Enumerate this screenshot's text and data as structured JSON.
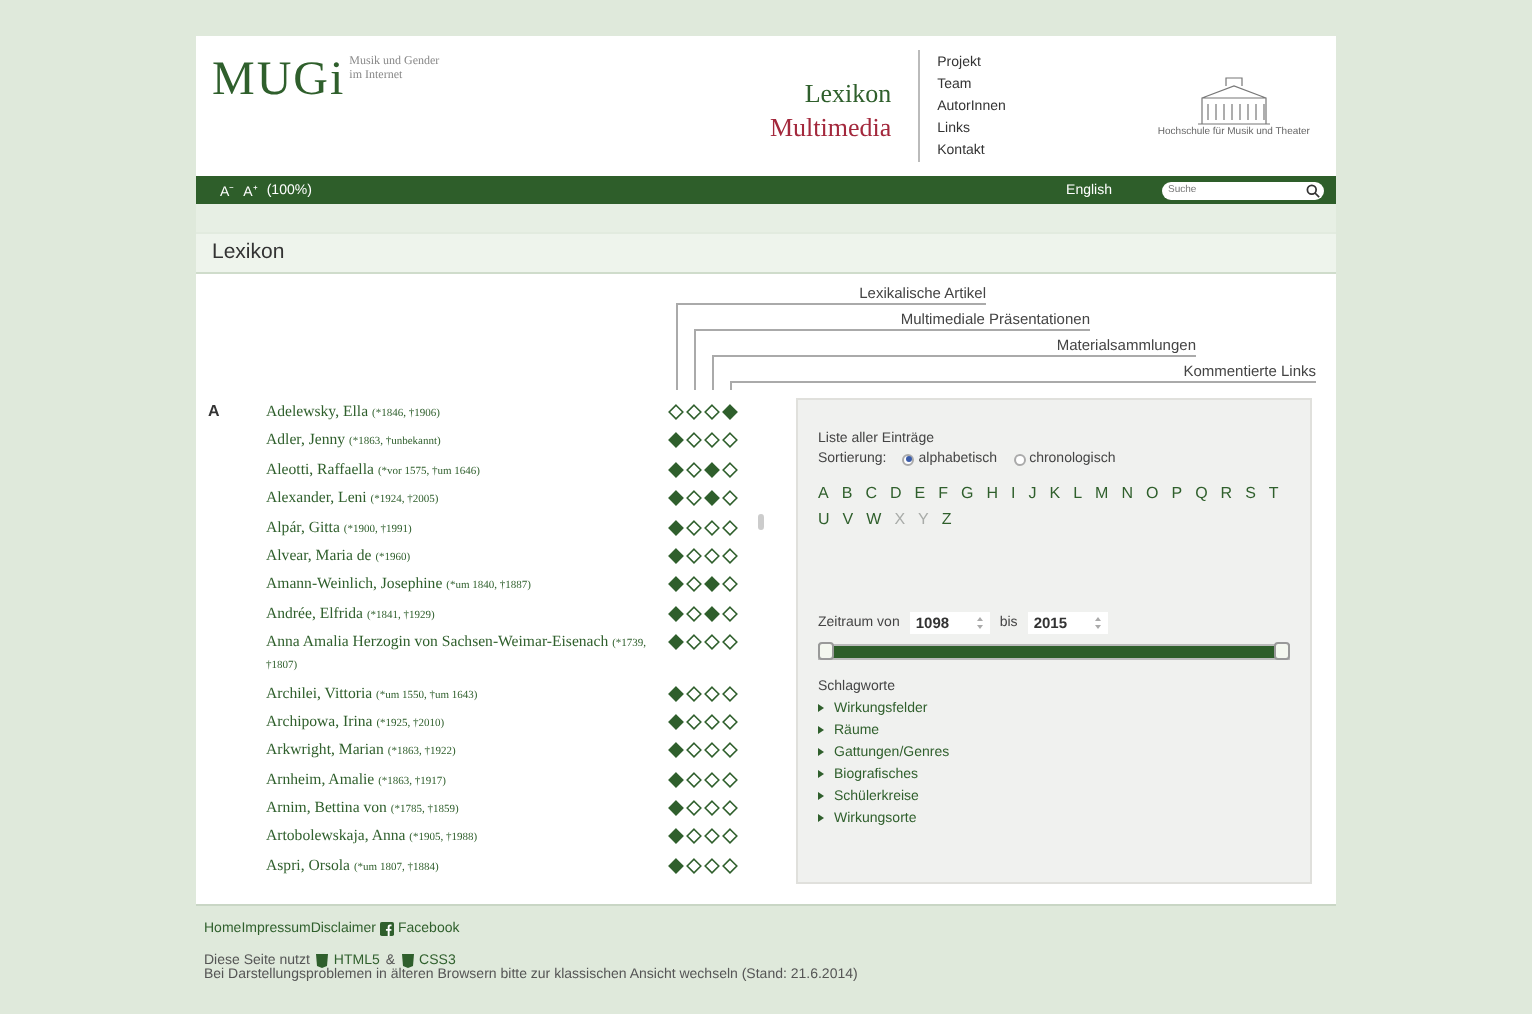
{
  "header": {
    "logo": "MUGi",
    "logo_subtitle": "Musik und Gender im Internet",
    "sections": [
      {
        "label": "Lexikon",
        "color": "#2f5f2c"
      },
      {
        "label": "Multimedia",
        "color": "#a3283c"
      }
    ],
    "nav": [
      "Projekt",
      "Team",
      "AutorInnen",
      "Links",
      "Kontakt"
    ],
    "institution": "Hochschule für Musik und Theater"
  },
  "toolbar": {
    "font_buttons": [
      "A⁻",
      "A⁺"
    ],
    "zoom": "(100%)",
    "language": "English",
    "search": {
      "placeholder": "Suche"
    }
  },
  "page_title": "Lexikon",
  "legend": [
    "Lexikalische Artikel",
    "Multimediale Präsentationen",
    "Materialsammlungen",
    "Kommentierte Links"
  ],
  "letter": "A",
  "entries": [
    {
      "name": "Adelewsky, Ella",
      "dates": "(*1846, †1906)",
      "flags": [
        false,
        false,
        false,
        true
      ]
    },
    {
      "name": "Adler, Jenny",
      "dates": "(*1863, †unbekannt)",
      "flags": [
        true,
        false,
        false,
        false
      ]
    },
    {
      "name": "Aleotti, Raffaella",
      "dates": "(*vor 1575, †um 1646)",
      "flags": [
        true,
        false,
        true,
        false
      ]
    },
    {
      "name": "Alexander, Leni",
      "dates": "(*1924, †2005)",
      "flags": [
        true,
        false,
        true,
        false
      ]
    },
    {
      "name": "Alpár, Gitta",
      "dates": "(*1900, †1991)",
      "flags": [
        true,
        false,
        false,
        false
      ]
    },
    {
      "name": "Alvear, Maria de",
      "dates": "(*1960)",
      "flags": [
        true,
        false,
        false,
        false
      ]
    },
    {
      "name": "Amann-Weinlich, Josephine",
      "dates": "(*um 1840, †1887)",
      "flags": [
        true,
        false,
        true,
        false
      ]
    },
    {
      "name": "Andrée, Elfrida",
      "dates": "(*1841, †1929)",
      "flags": [
        true,
        false,
        true,
        false
      ]
    },
    {
      "name": "Anna Amalia Herzogin von Sachsen-Weimar-Eisenach",
      "dates": "(*1739, †1807)",
      "flags": [
        true,
        false,
        false,
        false
      ]
    },
    {
      "name": "Archilei, Vittoria",
      "dates": "(*um 1550, †um 1643)",
      "flags": [
        true,
        false,
        false,
        false
      ]
    },
    {
      "name": "Archipowa, Irina",
      "dates": "(*1925, †2010)",
      "flags": [
        true,
        false,
        false,
        false
      ]
    },
    {
      "name": "Arkwright, Marian",
      "dates": "(*1863, †1922)",
      "flags": [
        true,
        false,
        false,
        false
      ]
    },
    {
      "name": "Arnheim, Amalie",
      "dates": "(*1863, †1917)",
      "flags": [
        true,
        false,
        false,
        false
      ]
    },
    {
      "name": "Arnim, Bettina von",
      "dates": "(*1785, †1859)",
      "flags": [
        true,
        false,
        false,
        false
      ]
    },
    {
      "name": "Artobolewskaja, Anna",
      "dates": "(*1905, †1988)",
      "flags": [
        true,
        false,
        false,
        false
      ]
    },
    {
      "name": "Aspri, Orsola",
      "dates": "(*um 1807, †1884)",
      "flags": [
        true,
        false,
        false,
        false
      ]
    }
  ],
  "panel": {
    "heading": "Liste aller Einträge",
    "sort_label": "Sortierung:",
    "sort_options": [
      {
        "label": "alphabetisch",
        "selected": true
      },
      {
        "label": "chronologisch",
        "selected": false
      }
    ],
    "letters": [
      {
        "label": "A",
        "disabled": false
      },
      {
        "label": "B",
        "disabled": false
      },
      {
        "label": "C",
        "disabled": false
      },
      {
        "label": "D",
        "disabled": false
      },
      {
        "label": "E",
        "disabled": false
      },
      {
        "label": "F",
        "disabled": false
      },
      {
        "label": "G",
        "disabled": false
      },
      {
        "label": "H",
        "disabled": false
      },
      {
        "label": "I",
        "disabled": false
      },
      {
        "label": "J",
        "disabled": false
      },
      {
        "label": "K",
        "disabled": false
      },
      {
        "label": "L",
        "disabled": false
      },
      {
        "label": "M",
        "disabled": false
      },
      {
        "label": "N",
        "disabled": false
      },
      {
        "label": "O",
        "disabled": false
      },
      {
        "label": "P",
        "disabled": false
      },
      {
        "label": "Q",
        "disabled": false
      },
      {
        "label": "R",
        "disabled": false
      },
      {
        "label": "S",
        "disabled": false
      },
      {
        "label": "T",
        "disabled": false
      },
      {
        "label": "U",
        "disabled": false
      },
      {
        "label": "V",
        "disabled": false
      },
      {
        "label": "W",
        "disabled": false
      },
      {
        "label": "X",
        "disabled": true
      },
      {
        "label": "Y",
        "disabled": true
      },
      {
        "label": "Z",
        "disabled": false
      }
    ],
    "range": {
      "label_from": "Zeitraum von",
      "from": "1098",
      "label_to": "bis",
      "to": "2015",
      "level": 1
    },
    "keywords_title": "Schlagworte",
    "keywords": [
      "Wirkungsfelder",
      "Räume",
      "Gattungen/Genres",
      "Biografisches",
      "Schülerkreise",
      "Wirkungsorte"
    ]
  },
  "footer": {
    "links": [
      "Home",
      "Impressum",
      "Disclaimer"
    ],
    "facebook": "Facebook",
    "tech_prefix": "Diese Seite nutzt",
    "html": "HTML5",
    "amp": "&",
    "css": "CSS3",
    "notice": "Bei Darstellungsproblemen in älteren Browsern bitte zur klassischen Ansicht wechseln (Stand: 21.6.2014)"
  }
}
